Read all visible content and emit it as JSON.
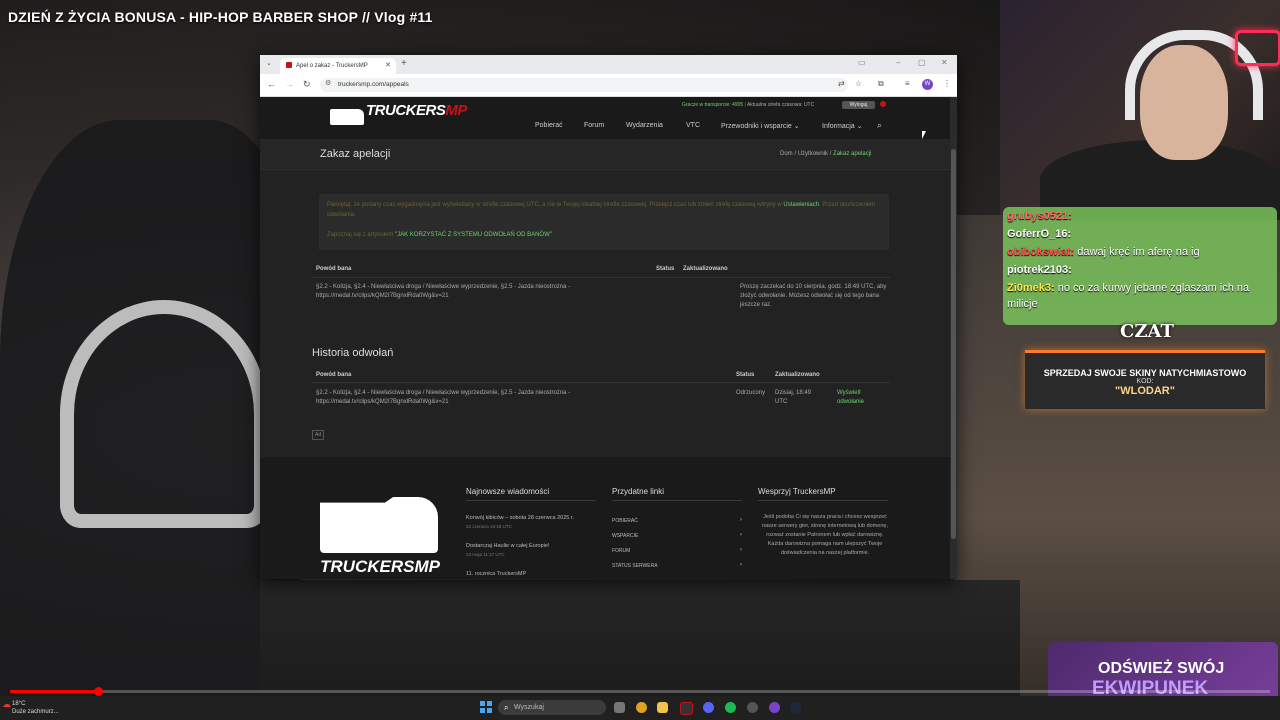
{
  "video": {
    "title": "DZIEŃ Z ŻYCIA BONUSA - HIP-HOP BARBER SHOP // Vlog #11"
  },
  "browser": {
    "tab_title": "Apel o zakaz - TruckersMP",
    "url": "truckersmp.com/appeals"
  },
  "site": {
    "logo_a": "TRUCKERS",
    "logo_b": "MP",
    "top_players": "Gracze w transporcie: 4905",
    "top_time": "Aktualna strefa czasowa: UTC",
    "lang_button": "Wyloguj",
    "nav": [
      "Pobierać",
      "Forum",
      "Wydarzenia",
      "VTC",
      "Przewodniki i wsparcie ⌄",
      "Informacja ⌄"
    ],
    "page_title": "Zakaz apelacji",
    "breadcrumb": {
      "home": "Dom",
      "sep": "/",
      "user": "Użytkownik",
      "current": "Zakaz apelacji"
    },
    "alert_line1_a": "Pamiętaj, że podany czas wygaśnięcia jest wyświetlany w strefie czasowej UTC, a nie w Twojej lokalnej strefie czasowej. Przełącz czas lub zmień strefę czasową witryny w",
    "alert_link1": "Ustawieniach",
    "alert_line1_b": ". Przed ukończeniem odwołania.",
    "alert_line2_a": "Zapoznaj się z artykułem",
    "alert_link2": "\"JAK KORZYSTAĆ Z SYSTEMU ODWOŁAŃ OD BANÓW\"",
    "ban_table": {
      "col_reason": "Powód bana",
      "col_status": "Status",
      "col_updated": "Zaktualizowano",
      "reason": "§2.2 - Kolizja, §2.4 - Niewłaściwa droga / Niewłaściwe wyprzedzenie, §2.5 - Jazda nieostrożna - https://medal.tv/clips/kQM2I7BgnxlRda0Wg&v=21",
      "note": "Proszę zaczekać do 10 sierpnia, godz. 18:49 UTC, aby złożyć odwołanie. Możesz odwołać się od tego bana jeszcze raz."
    },
    "history_title": "Historia odwołań",
    "history_table": {
      "col_reason": "Powód bana",
      "col_status": "Status",
      "col_updated": "Zaktualizowano",
      "reason": "§2.2 - Kolizja, §2.4 - Niewłaściwa droga / Niewłaściwe wyprzedzenie, §2.5 - Jazda nieostrożna - https://medal.tv/clips/kQM2I7BgnxlRda0Wg&v=21",
      "status": "Odrzucony",
      "updated": "Dzisiaj, 18:49 UTC",
      "action": "Wyświetl odwołanie"
    },
    "ad_label": "Ad",
    "footer": {
      "news_title": "Najnowsze wiadomości",
      "news": [
        {
          "title": "Konwój kibiców – sobota 28 czerwca 2025 r.",
          "date": "22 czerwca 16:18 UTC"
        },
        {
          "title": "Dostarczaj Haulie w całej Europie!",
          "date": "23 maja 11:17 UTC"
        },
        {
          "title": "11. rocznica TruckersMP",
          "date": ""
        }
      ],
      "links_title": "Przydatne linki",
      "links": [
        "POBIERAĆ",
        "WSPARCIE",
        "FORUM",
        "STATUS SERWERA"
      ],
      "support_title": "Wesprzyj TruckersMP",
      "support_text": "Jeśli podoba Ci się nasza praca i chcesz wesprzeć nasze serwery gier, stronę internetową lub domenę, rozważ zostanie Patronem lub wpłać darowiznę. Każda darowizna pomaga nam ulepszyć Twoje doświadczenia na naszej platformie."
    }
  },
  "chat": {
    "lines": [
      {
        "user": "grubys0521:",
        "text": ""
      },
      {
        "user": "GoferrO_16:",
        "text": ""
      },
      {
        "user": "obibokswiat:",
        "text": "dawaj kręć im aferę na ig"
      },
      {
        "user": "piotrek2103:",
        "text": ""
      },
      {
        "user": "Zi0mek3:",
        "text": "no co za kurwy jebane zglaszam ich na milicje"
      }
    ],
    "title": "CZAT"
  },
  "promo": {
    "main": "SPRZEDAJ SWOJE SKINY NATYCHMIASTOWO",
    "code_label": "KOD:",
    "code": "\"WLODAR\""
  },
  "refresh": {
    "line1": "ODŚWIEŻ SWÓJ",
    "line2": "EKWIPUNEK"
  },
  "taskbar": {
    "temp": "18°C",
    "weather": "Duże zachmurz...",
    "search_placeholder": "Wyszukaj"
  },
  "video_progress": 0.07
}
